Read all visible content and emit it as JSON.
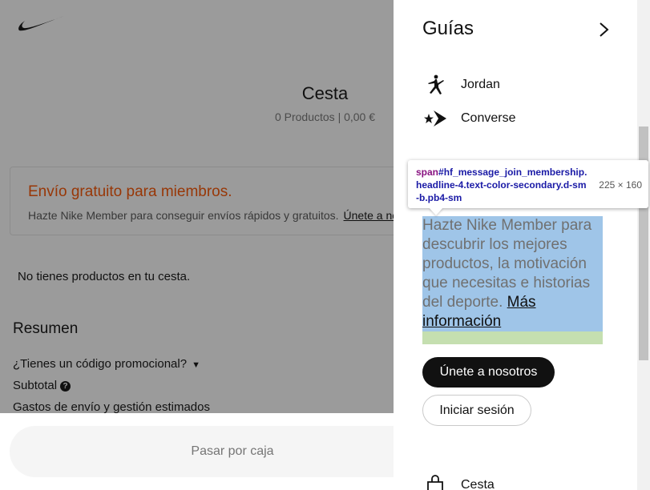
{
  "background": {
    "cart": {
      "title": "Cesta",
      "subtitle": "0 Productos | 0,00 €"
    },
    "promo": {
      "title": "Envío gratuito para miembros.",
      "text": "Hazte Nike Member para conseguir envíos rápidos y gratuitos.",
      "link": "Únete a nosotros"
    },
    "empty_message": "No tienes productos en tu cesta.",
    "summary": {
      "title": "Resumen",
      "promo_code": "¿Tienes un código promocional?",
      "subtotal": "Subtotal",
      "shipping": "Gastos de envío y gestión estimados"
    },
    "checkout_label": "Pasar por caja",
    "colors": {
      "promo_accent": "#fa5400",
      "overlay": "#111111"
    }
  },
  "panel": {
    "guides_title": "Guías",
    "brands": [
      {
        "label": "Jordan",
        "icon": "jumpman-icon"
      },
      {
        "label": "Converse",
        "icon": "converse-star-chevron-icon"
      }
    ],
    "join_message": "Hazte Nike Member para descubrir los mejores productos, la motivación que necesitas e historias del deporte.",
    "join_more": "Más información",
    "join_button": "Únete a nosotros",
    "login_button": "Iniciar sesión",
    "bag_label": "Cesta"
  },
  "tooltip": {
    "tag": "span",
    "selector": "#hf_message_join_membership.headline-4.text-color-secondary.d-sm-b.pb4-sm",
    "size": "225 × 160",
    "highlight_colors": {
      "content": "#9fc5e8",
      "padding": "#c5dfb0"
    }
  }
}
